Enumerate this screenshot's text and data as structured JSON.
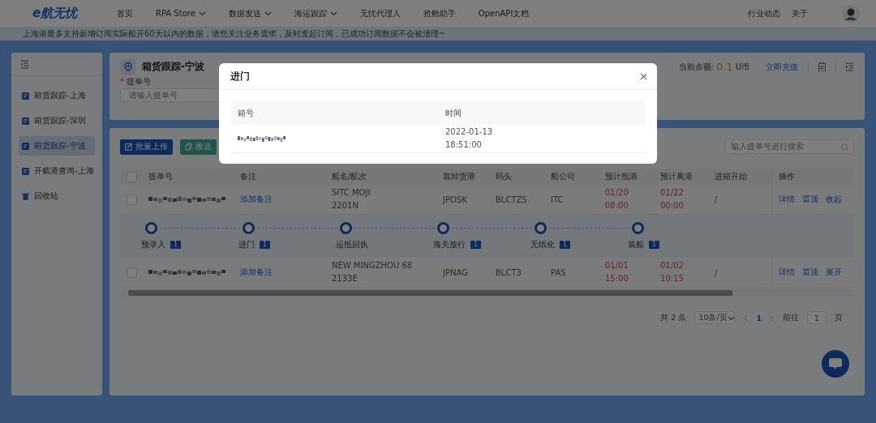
{
  "header": {
    "logo": "e航无忧",
    "nav": [
      {
        "label": "首页",
        "dropdown": false
      },
      {
        "label": "RPA Store",
        "dropdown": true
      },
      {
        "label": "数据发送",
        "dropdown": true
      },
      {
        "label": "海运跟踪",
        "dropdown": true
      },
      {
        "label": "无忧代理人",
        "dropdown": false
      },
      {
        "label": "抢舱助手",
        "dropdown": false
      },
      {
        "label": "OpenAPI文档",
        "dropdown": false
      }
    ],
    "right_links": [
      "行业动态",
      "关于"
    ]
  },
  "notice": "上海港最多支持新增订阅实际船开60天以内的数据，请您关注业务需求，及时发起订阅，已成功订阅数据不会被清理~",
  "sidebar": {
    "items": [
      {
        "label": "箱货跟踪-上海",
        "selected": false,
        "kind": "doc"
      },
      {
        "label": "箱货跟踪-深圳",
        "selected": false,
        "kind": "doc"
      },
      {
        "label": "箱货跟踪-宁波",
        "selected": true,
        "kind": "doc"
      },
      {
        "label": "开截港查询-上海",
        "selected": false,
        "kind": "doc"
      },
      {
        "label": "回收站",
        "selected": false,
        "kind": "bin"
      }
    ]
  },
  "page": {
    "title": "箱货跟踪-宁波",
    "field": {
      "required_mark": "*",
      "label": "提单号",
      "placeholder": "请输入提单号"
    },
    "balance_label": "当前余额:",
    "balance": "0.1",
    "balance_unit": "U币",
    "recharge": "立即充值"
  },
  "toolbar": {
    "buttons": [
      {
        "label": "批量上传",
        "kind": "primary"
      },
      {
        "label": "推送",
        "kind": "teal"
      }
    ],
    "search_placeholder": "输入提单号进行搜索"
  },
  "table": {
    "select_all_checked": false,
    "columns": [
      "提单号",
      "备注",
      "船名/航次",
      "装卸货港",
      "码头",
      "船公司",
      "预计抵港",
      "预计离港",
      "进箱开始",
      "操作"
    ],
    "rows": [
      {
        "checked": false,
        "remark": "添加备注",
        "vessel": "SITC MOJI",
        "voyage": "2201N",
        "port": "JPOSK",
        "terminal": "BLCTZS",
        "carrier": "ITC",
        "eta": [
          "01/20",
          "08:00"
        ],
        "etd": [
          "01/22",
          "00:00"
        ],
        "gate_open": "/",
        "actions": [
          "详情",
          "置顶",
          "收起"
        ],
        "expanded": true,
        "timeline": [
          {
            "label": "预录入",
            "count": "1"
          },
          {
            "label": "进门",
            "count": "1"
          },
          {
            "label": "运抵回执"
          },
          {
            "label": "海关放行",
            "count": "1"
          },
          {
            "label": "无纸化",
            "count": "1"
          },
          {
            "label": "装船",
            "count": "1"
          }
        ]
      },
      {
        "checked": false,
        "remark": "添加备注",
        "vessel": "NEW MINGZHOU 68",
        "voyage": "2133E",
        "port": "JPNAG",
        "terminal": "BLCT3",
        "carrier": "PAS",
        "eta": [
          "01/01",
          "15:00"
        ],
        "etd": [
          "01/02",
          "10:15"
        ],
        "gate_open": "/",
        "actions": [
          "详情",
          "置顶",
          "展开"
        ],
        "expanded": false
      }
    ]
  },
  "pagination": {
    "total": "共 2 条",
    "page_size": "10条/页",
    "pages": [
      {
        "label": "1",
        "selected": true
      }
    ],
    "goto_label": "前往",
    "goto_value": "1",
    "goto_unit": "页"
  },
  "modal": {
    "title": "进门",
    "columns": [
      "箱号",
      "时间"
    ],
    "rows": [
      {
        "time": [
          "2022-01-13",
          "18:51:00"
        ]
      }
    ]
  }
}
